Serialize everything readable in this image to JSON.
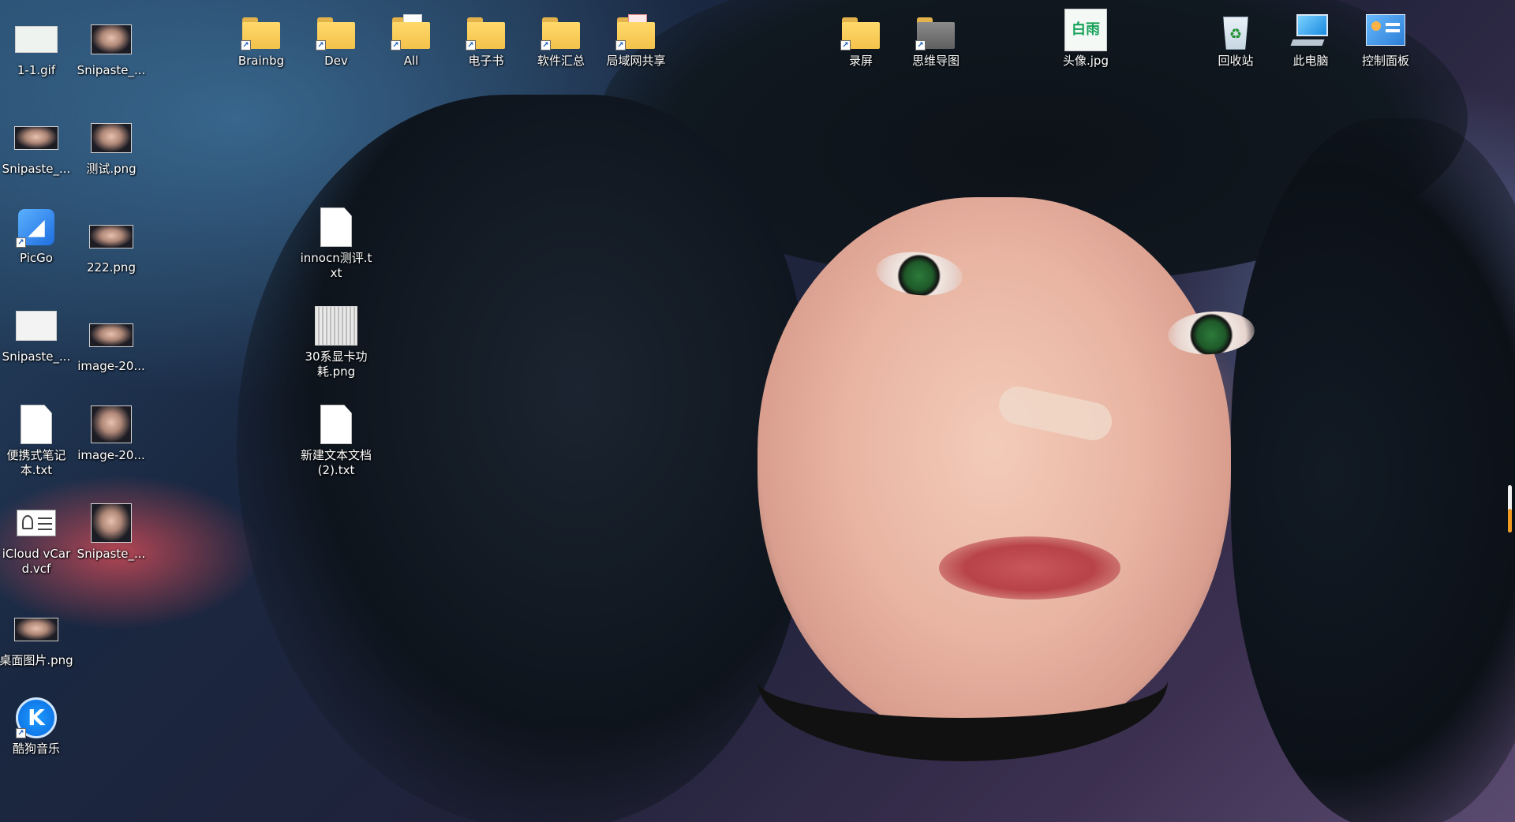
{
  "desktop": {
    "icons": [
      {
        "label": "1-1.gif",
        "icon": "gif-image-icon"
      },
      {
        "label": "Snipaste_...",
        "icon": "image-thumbnail-icon"
      },
      {
        "label": "Snipaste_...",
        "icon": "image-thumbnail-icon"
      },
      {
        "label": "测试.png",
        "icon": "image-thumbnail-icon"
      },
      {
        "label": "PicGo",
        "icon": "picgo-app-icon"
      },
      {
        "label": "222.png",
        "icon": "image-thumbnail-icon"
      },
      {
        "label": "Snipaste_...",
        "icon": "document-thumbnail-icon"
      },
      {
        "label": "image-20...",
        "icon": "image-thumbnail-icon"
      },
      {
        "label": "便携式笔记本.txt",
        "icon": "text-file-icon"
      },
      {
        "label": "image-20...",
        "icon": "image-thumbnail-icon"
      },
      {
        "label": "iCloud vCard.vcf",
        "icon": "vcard-icon"
      },
      {
        "label": "Snipaste_...",
        "icon": "image-thumbnail-icon"
      },
      {
        "label": "桌面图片.png",
        "icon": "image-thumbnail-icon"
      },
      {
        "label": "酷狗音乐",
        "icon": "kugou-music-app-icon"
      },
      {
        "label": "innocn测评.txt",
        "icon": "text-file-icon"
      },
      {
        "label": "30系显卡功耗.png",
        "icon": "image-thumbnail-icon"
      },
      {
        "label": "新建文本文档 (2).txt",
        "icon": "text-file-icon"
      },
      {
        "label": "Brainbg",
        "icon": "folder-shortcut-icon"
      },
      {
        "label": "Dev",
        "icon": "folder-shortcut-icon"
      },
      {
        "label": "All",
        "icon": "folder-shortcut-icon"
      },
      {
        "label": "电子书",
        "icon": "folder-shortcut-icon"
      },
      {
        "label": "软件汇总",
        "icon": "folder-shortcut-icon"
      },
      {
        "label": "局域网共享",
        "icon": "folder-shortcut-icon"
      },
      {
        "label": "录屏",
        "icon": "folder-shortcut-icon"
      },
      {
        "label": "思维导图",
        "icon": "folder-shortcut-icon"
      },
      {
        "label": "头像.jpg",
        "icon": "image-thumbnail-icon",
        "glyph": "白雨"
      },
      {
        "label": "回收站",
        "icon": "recycle-bin-icon"
      },
      {
        "label": "此电脑",
        "icon": "this-pc-icon"
      },
      {
        "label": "控制面板",
        "icon": "control-panel-icon"
      }
    ]
  }
}
